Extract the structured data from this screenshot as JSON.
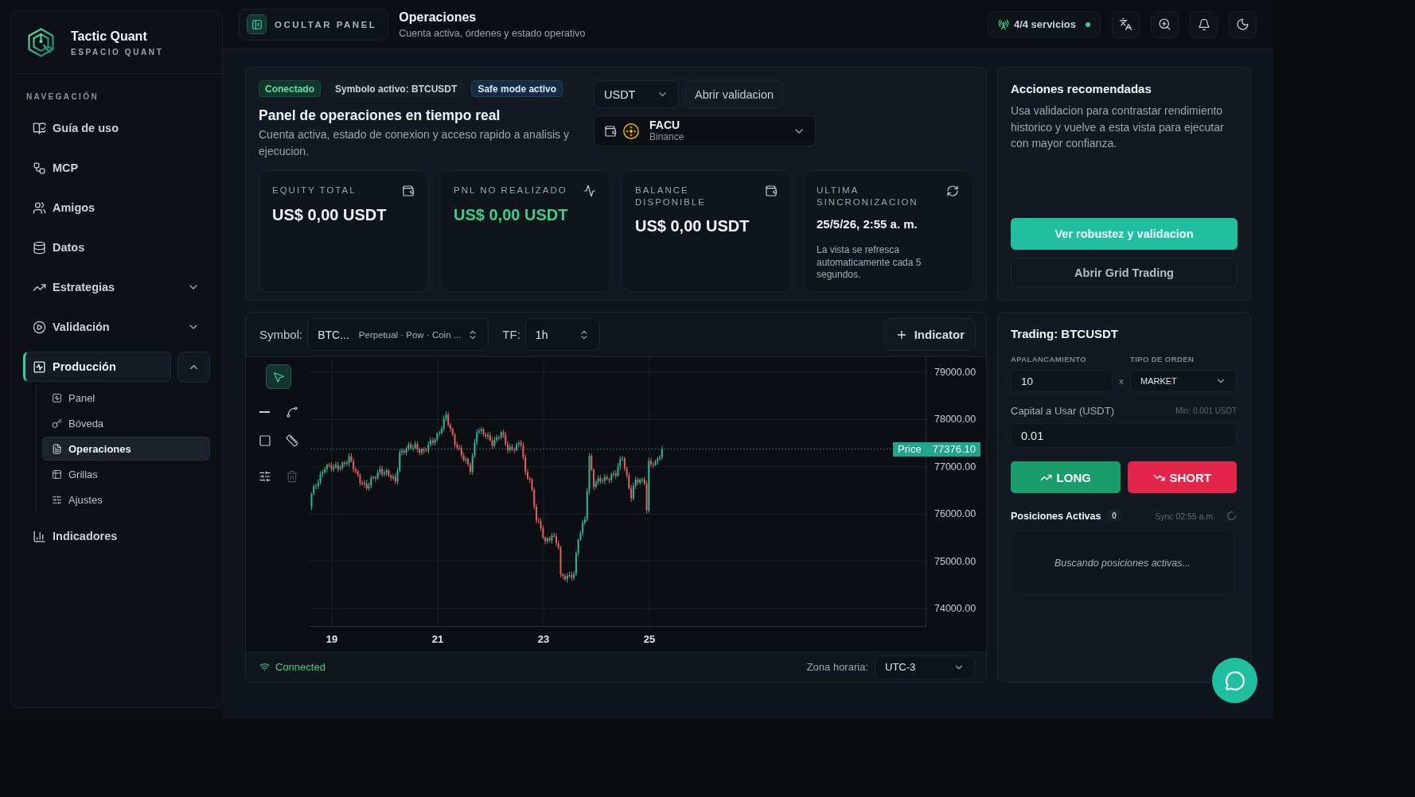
{
  "sidebar": {
    "brand": {
      "name": "Tactic Quant",
      "tagline": "ESPACIO QUANT"
    },
    "section_title": "NAVEGACIÓN",
    "items": [
      {
        "label": "Guía de uso",
        "selected": false
      },
      {
        "label": "MCP",
        "selected": false
      },
      {
        "label": "Amigos",
        "selected": false
      },
      {
        "label": "Datos",
        "selected": false
      },
      {
        "label": "Estrategias",
        "selected": false,
        "expanded": false
      },
      {
        "label": "Validación",
        "selected": false,
        "expanded": false
      },
      {
        "label": "Producción",
        "selected": true,
        "expanded": true,
        "children": [
          {
            "label": "Panel",
            "selected": false
          },
          {
            "label": "Bóveda",
            "selected": false
          },
          {
            "label": "Operaciones",
            "selected": true
          },
          {
            "label": "Grillas",
            "selected": false
          },
          {
            "label": "Ajustes",
            "selected": false
          }
        ]
      },
      {
        "label": "Indicadores",
        "selected": false
      }
    ]
  },
  "header": {
    "toggle_button": "OCULTAR PANEL",
    "title": "Operaciones",
    "subtitle": "Cuenta activa, órdenes y estado operativo",
    "services": {
      "label": "4/4 servicios",
      "online": true
    }
  },
  "overview": {
    "badges": [
      {
        "label": "Conectado",
        "kind": "success"
      },
      {
        "label": "Symbolo activo: BTCUSDT",
        "kind": "neutral"
      },
      {
        "label": "Safe mode activo",
        "kind": "info"
      }
    ],
    "title": "Panel de operaciones en tiempo real",
    "description": "Cuenta activa, estado de conexion y acceso rapido a analisis y ejecucion.",
    "currency": "USDT",
    "validation_button": "Abrir validacion",
    "account": {
      "name": "FACU",
      "exchange": "Binance"
    },
    "stats": [
      {
        "kind": "balance",
        "label": "EQUITY TOTAL",
        "value": "US$ 0,00 USDT"
      },
      {
        "kind": "pnl",
        "label": "PNL NO REALIZADO",
        "value": "US$ 0,00 USDT"
      },
      {
        "kind": "balance",
        "label": "BALANCE DISPONIBLE",
        "value": "US$ 0,00 USDT"
      },
      {
        "kind": "sync",
        "label": "ULTIMA SINCRONIZACION",
        "value": "25/5/26, 2:55 a. m.",
        "note": "La vista se refresca automaticamente cada 5 segundos."
      }
    ]
  },
  "recommended": {
    "title": "Acciones recomendadas",
    "text": "Usa validacion para contrastar rendimiento historico y vuelve a esta vista para ejecutar con mayor confianza.",
    "primary_button": "Ver robustez y validacion",
    "secondary_button": "Abrir Grid Trading"
  },
  "chart": {
    "symbol_label": "Symbol:",
    "symbol": "BTC...",
    "symbol_detail": "Perpetual · Pow · Coin ...",
    "timeframe_label": "TF:",
    "timeframe": "1h",
    "indicator_button": "Indicator",
    "tools": [
      {
        "selected": true,
        "disabled": false
      },
      {
        "selected": false,
        "disabled": false
      },
      {
        "selected": false,
        "disabled": false
      },
      {
        "selected": false,
        "disabled": false
      },
      {
        "selected": false,
        "disabled": false
      },
      {
        "selected": false,
        "disabled": false
      },
      {
        "selected": false,
        "disabled": true
      }
    ],
    "price_ticks": [
      "79000.00",
      "78000.00",
      "77000.00",
      "76000.00",
      "75000.00",
      "74000.00"
    ],
    "date_ticks": [
      "19",
      "21",
      "23",
      "25"
    ],
    "last_price": {
      "label": "Price",
      "value": "77376.10"
    },
    "connection": "Connected",
    "timezone_label": "Zona horaria:",
    "timezone": "UTC-3"
  },
  "trading": {
    "title": "Trading: BTCUSDT",
    "leverage_label": "APALANCAMIENTO",
    "leverage": "10",
    "leverage_suffix": "x",
    "order_type_label": "TIPO DE ORDEN",
    "order_type": "MARKET",
    "capital_label": "Capital a Usar (USDT)",
    "capital_hint": "Min: 0.001 USDT",
    "capital": "0.01",
    "long_button": "LONG",
    "short_button": "SHORT",
    "positions_title": "Posiciones Activas",
    "positions_count": "0",
    "sync_text": "Sync 02:55 a.m.",
    "empty_text": "Buscando posiciones activas..."
  }
}
